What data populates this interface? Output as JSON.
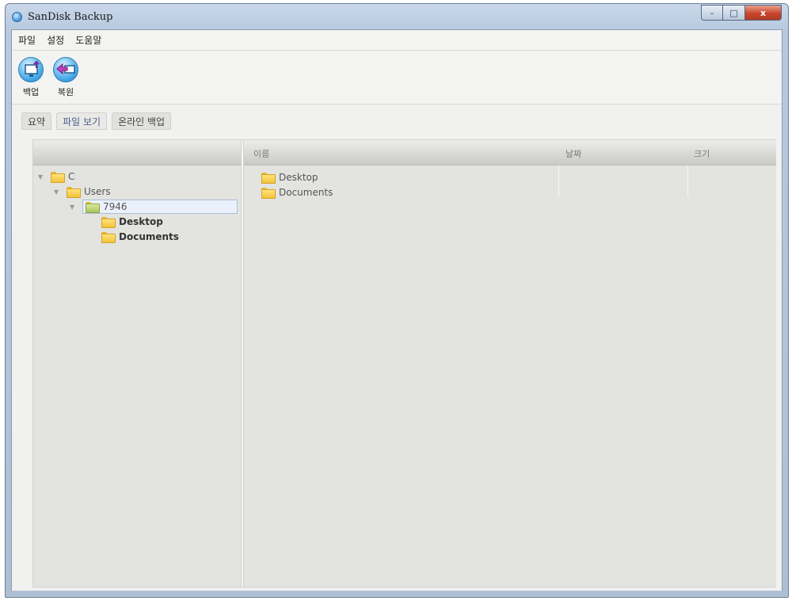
{
  "window": {
    "title": "SanDisk Backup",
    "min": "–",
    "max": "□",
    "close": "x"
  },
  "menu": [
    {
      "label": "파일"
    },
    {
      "label": "설정"
    },
    {
      "label": "도움말"
    }
  ],
  "toolbar": {
    "backup_label": "백업",
    "restore_label": "복원"
  },
  "tabs": [
    {
      "label": "요약"
    },
    {
      "label": "파일 보기"
    },
    {
      "label": "온라인 백업"
    }
  ],
  "tree": [
    {
      "label": "C"
    },
    {
      "label": "Users"
    },
    {
      "label": "7946"
    },
    {
      "label": "Desktop"
    },
    {
      "label": "Documents"
    }
  ],
  "columns": {
    "name": "이름",
    "date": "날짜",
    "size": "크기"
  },
  "files": [
    {
      "name": "Desktop"
    },
    {
      "name": "Documents"
    }
  ]
}
